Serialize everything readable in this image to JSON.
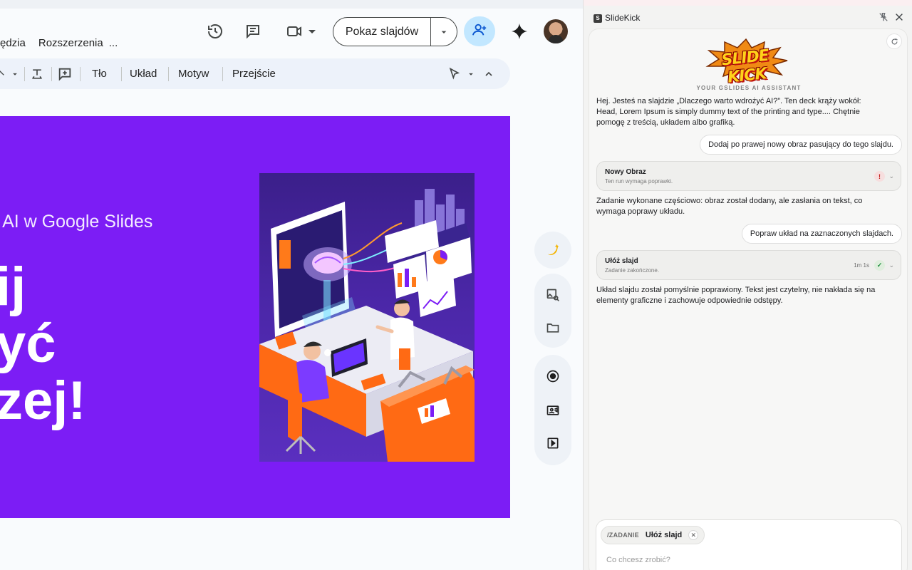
{
  "editor": {
    "menu": {
      "tools": "ędzia",
      "extensions": "Rozszerzenia",
      "more": "..."
    },
    "present_label": "Pokaz slajdów",
    "toolbar": {
      "background": "Tło",
      "layout": "Układ",
      "theme": "Motyw",
      "transition": "Przejście"
    },
    "slide": {
      "subtitle": "i AI w Google Slides",
      "line1": "ij",
      "line2": "yć",
      "line3": "zej!",
      "bg_color": "#7c1df5"
    }
  },
  "panel": {
    "title": "SlideKick",
    "logo_text": "SLIDE KICK",
    "tagline": "YOUR GSLIDES AI ASSISTANT",
    "messages": {
      "intro": "Hej. Jesteś na slajdzie „Dlaczego warto wdrożyć AI?”. Ten deck krąży wokół: Head, Lorem Ipsum is simply dummy text of the printing and type.... Chętnie pomogę z treścią, układem albo grafiką.",
      "user1": "Dodaj po prawej nowy obraz pasujący do tego slajdu.",
      "task1": {
        "name": "Nowy Obraz",
        "status": "Ten run wymaga poprawki."
      },
      "reply1": "Zadanie wykonane częściowo: obraz został dodany, ale zasłania on tekst, co wymaga poprawy układu.",
      "user2": "Popraw układ na zaznaczonych slajdach.",
      "task2": {
        "name": "Ułóż slajd",
        "status": "Zadanie zakończone.",
        "time": "1m 1s"
      },
      "reply2": "Układ slajdu został pomyślnie poprawiony. Tekst jest czytelny, nie nakłada się na elementy graficzne i zachowuje odpowiednie odstępy."
    },
    "composer": {
      "command": "/ZADANIE",
      "command_value": "Ułóż slajd",
      "placeholder": "Co chcesz zrobić?"
    }
  }
}
